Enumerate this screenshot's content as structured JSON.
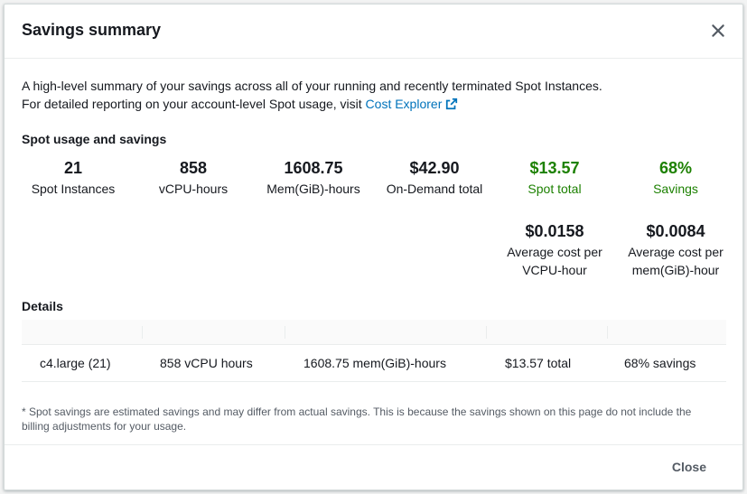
{
  "modal": {
    "title": "Savings summary",
    "intro_line1": "A high-level summary of your savings across all of your running and recently terminated Spot Instances.",
    "intro_line2_prefix": "For detailed reporting on your account-level Spot usage, visit ",
    "cost_explorer_link": "Cost Explorer",
    "close_button": "Close"
  },
  "usage": {
    "section_title": "Spot usage and savings",
    "stats": [
      {
        "value": "21",
        "label": "Spot Instances"
      },
      {
        "value": "858",
        "label": "vCPU-hours"
      },
      {
        "value": "1608.75",
        "label": "Mem(GiB)-hours"
      },
      {
        "value": "$42.90",
        "label": "On-Demand total"
      },
      {
        "value": "$13.57",
        "label": "Spot total"
      },
      {
        "value": "68%",
        "label": "Savings"
      }
    ],
    "avg": [
      {
        "value": "$0.0158",
        "label1": "Average cost per",
        "label2": "VCPU-hour"
      },
      {
        "value": "$0.0084",
        "label1": "Average cost per",
        "label2": "mem(GiB)-hour"
      }
    ]
  },
  "details": {
    "section_title": "Details",
    "rows": [
      {
        "instance": "c4.large (21)",
        "vcpu": "858 vCPU hours",
        "mem": "1608.75 mem(GiB)-hours",
        "total": "$13.57 total",
        "savings": "68% savings"
      }
    ]
  },
  "footnote": "* Spot savings are estimated savings and may differ from actual savings. This is because the savings shown on this page do not include the billing adjustments for your usage.",
  "colors": {
    "link": "#0073bb",
    "savings_green": "#1d8102"
  },
  "icons": {
    "close": "close-icon",
    "external": "external-link-icon"
  }
}
